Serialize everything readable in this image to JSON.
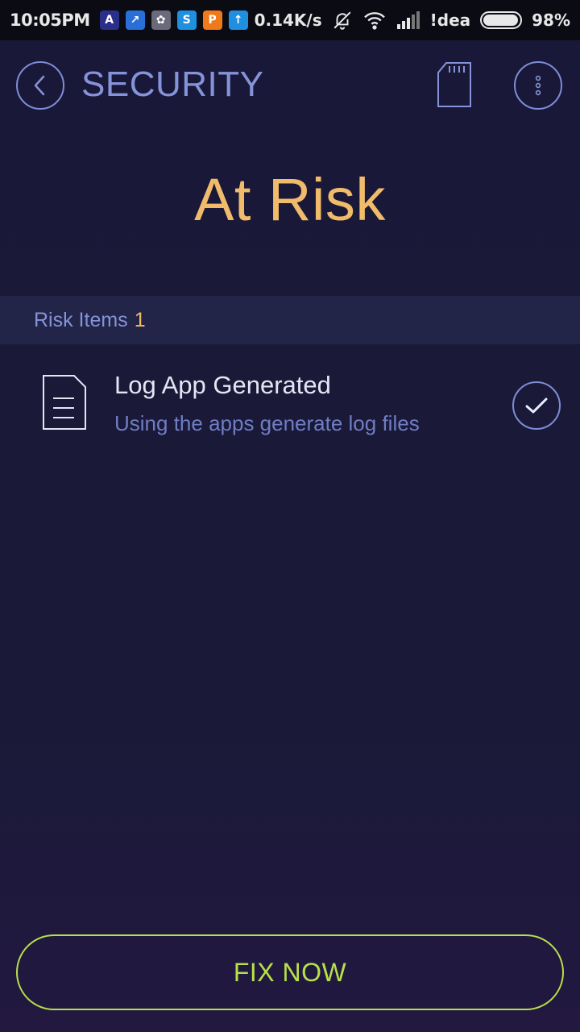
{
  "status_bar": {
    "time": "10:05PM",
    "network_speed": "0.14K/s",
    "carrier": "!dea",
    "battery": "98%",
    "battery_level": 0.98,
    "notifications": [
      {
        "icon": "app-a-icon",
        "color": "#2a2f8a",
        "glyph": "A"
      },
      {
        "icon": "app-chart-icon",
        "color": "#2a6fd8",
        "glyph": "↗"
      },
      {
        "icon": "app-pinwheel-icon",
        "color": "#6a6a7a",
        "glyph": "✿"
      },
      {
        "icon": "skype-icon",
        "color": "#1f8fe0",
        "glyph": "S"
      },
      {
        "icon": "app-orange-icon",
        "color": "#f07a1a",
        "glyph": "P"
      },
      {
        "icon": "upload-icon",
        "color": "#1f8fe0",
        "glyph": "↑"
      }
    ]
  },
  "header": {
    "title": "SECURITY"
  },
  "status_heading": "At Risk",
  "risk_summary": {
    "label": "Risk Items",
    "count": "1"
  },
  "risk_items": [
    {
      "title": "Log App Generated",
      "description": "Using the apps generate log files",
      "icon": "document-icon",
      "checked": true
    }
  ],
  "actions": {
    "fix_label": "FIX NOW"
  },
  "colors": {
    "background": "#1a1838",
    "accent": "#8593d8",
    "warning": "#f0bb6a",
    "action": "#b8e04a"
  }
}
